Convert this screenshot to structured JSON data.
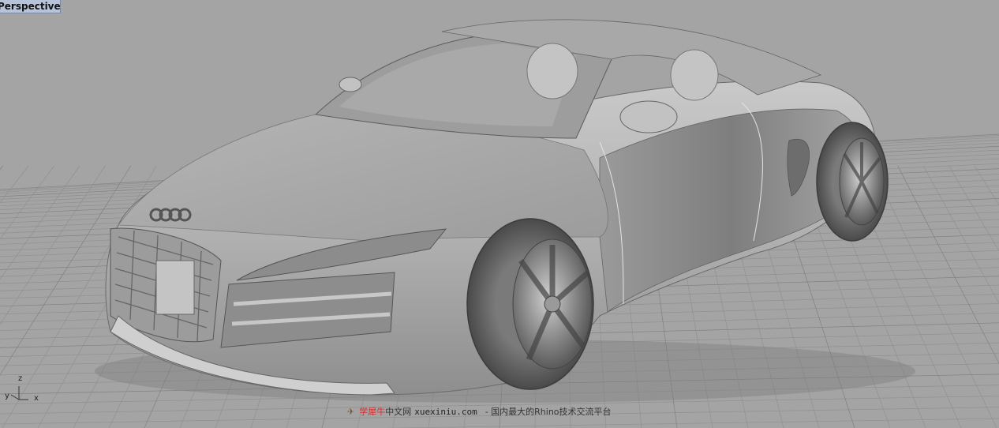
{
  "viewport": {
    "label": "Perspective"
  },
  "axis_widget": {
    "y_label": "y",
    "z_label": "z",
    "x_label": "x"
  },
  "watermark": {
    "brand": "学犀牛",
    "middle": "中文网",
    "url": "xuexiniu.com",
    "tagline": "- 国内最大的Rhino技术交流平台"
  },
  "colors": {
    "background": "#a4a4a4",
    "grid_line": "#8f8f8f",
    "grid_major": "#7d7d7d",
    "tab_background": "#b7c3d8",
    "model_shade": "#b8b8b8"
  }
}
